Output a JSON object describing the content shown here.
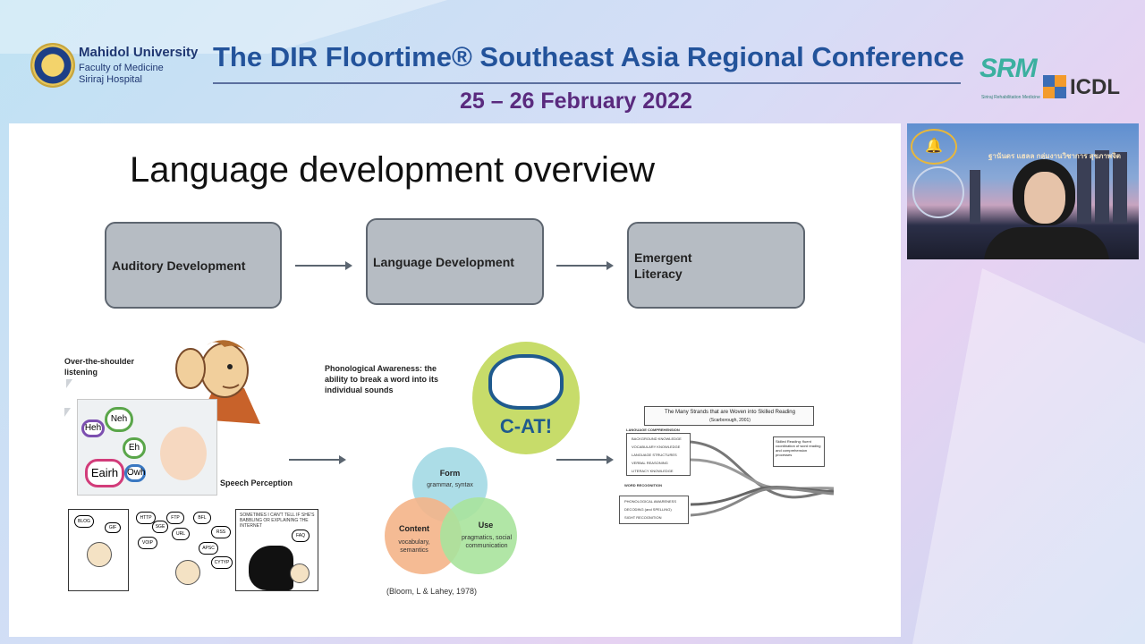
{
  "header": {
    "university_name": "Mahidol University",
    "faculty": "Faculty of Medicine",
    "hospital": "Siriraj Hospital",
    "conference_title": "The DIR Floortime® Southeast Asia Regional Conference",
    "conference_date": "25 – 26 February 2022",
    "srm_logo_text": "SRM",
    "srm_subtitle": "Siriraj Rehabilitation Medicine",
    "icdl_logo_text": "ICDL"
  },
  "slide": {
    "title": "Language development overview",
    "flow": [
      {
        "label": "Auditory Development"
      },
      {
        "label": "Language Development"
      },
      {
        "label": "Emergent Literacy"
      }
    ],
    "over_shoulder_label": "Over-the-shoulder listening",
    "speech_perception_label": "Speech Perception",
    "phonological_label": "Phonological Awareness: the ability to break a word into its individual sounds",
    "bubbles": [
      "Heh",
      "Neh",
      "Eh",
      "Eairh",
      "Owh"
    ],
    "comic_bubbles": [
      "BLOG",
      "GIF",
      "HTTP",
      "FTP",
      "BFL",
      "RSS",
      "URL",
      "APSC",
      "VOIP",
      "FAQ",
      "CYTYP",
      "SGE"
    ],
    "comic_caption": "SOMETIMES I CAN'T TELL IF SHE'S BABBLING OR EXPLAINING THE INTERNET",
    "cat_text": "C-AT!",
    "venn": {
      "form_title": "Form",
      "form_sub": "grammar, syntax",
      "content_title": "Content",
      "content_sub": "vocabulary, semantics",
      "use_title": "Use",
      "use_sub": "pragmatics, social communication"
    },
    "citation": "(Bloom, L & Lahey, 1978)",
    "reading_diagram": {
      "title": "The Many Strands that are Woven into Skilled Reading",
      "author": "(Scarborough, 2001)",
      "group1_title": "LANGUAGE COMPREHENSION",
      "group1_items": [
        "BACKGROUND KNOWLEDGE",
        "VOCABULARY KNOWLEDGE",
        "LANGUAGE STRUCTURES",
        "VERBAL REASONING",
        "LITERACY KNOWLEDGE"
      ],
      "group2_title": "WORD RECOGNITION",
      "group2_items": [
        "PHONOLOGICAL AWARENESS",
        "DECODING (and SPELLING)",
        "SIGHT RECOGNITION"
      ],
      "skilled_label": "Skilled Reading: fluent coordination of word reading and comprehension processes"
    }
  },
  "video": {
    "overlay_text": "ฐานันดร แฮลล\nกลุ่มงานวิชาการ สุขภาพจิต"
  },
  "colors": {
    "title_blue": "#23539b",
    "date_purple": "#5a2a7e",
    "flow_box_fill": "#b6bcc3",
    "venn_form": "#a8dbe6",
    "venn_content": "#f4b488",
    "venn_use": "#a9e39c",
    "cat_green": "#c7dc6a"
  }
}
